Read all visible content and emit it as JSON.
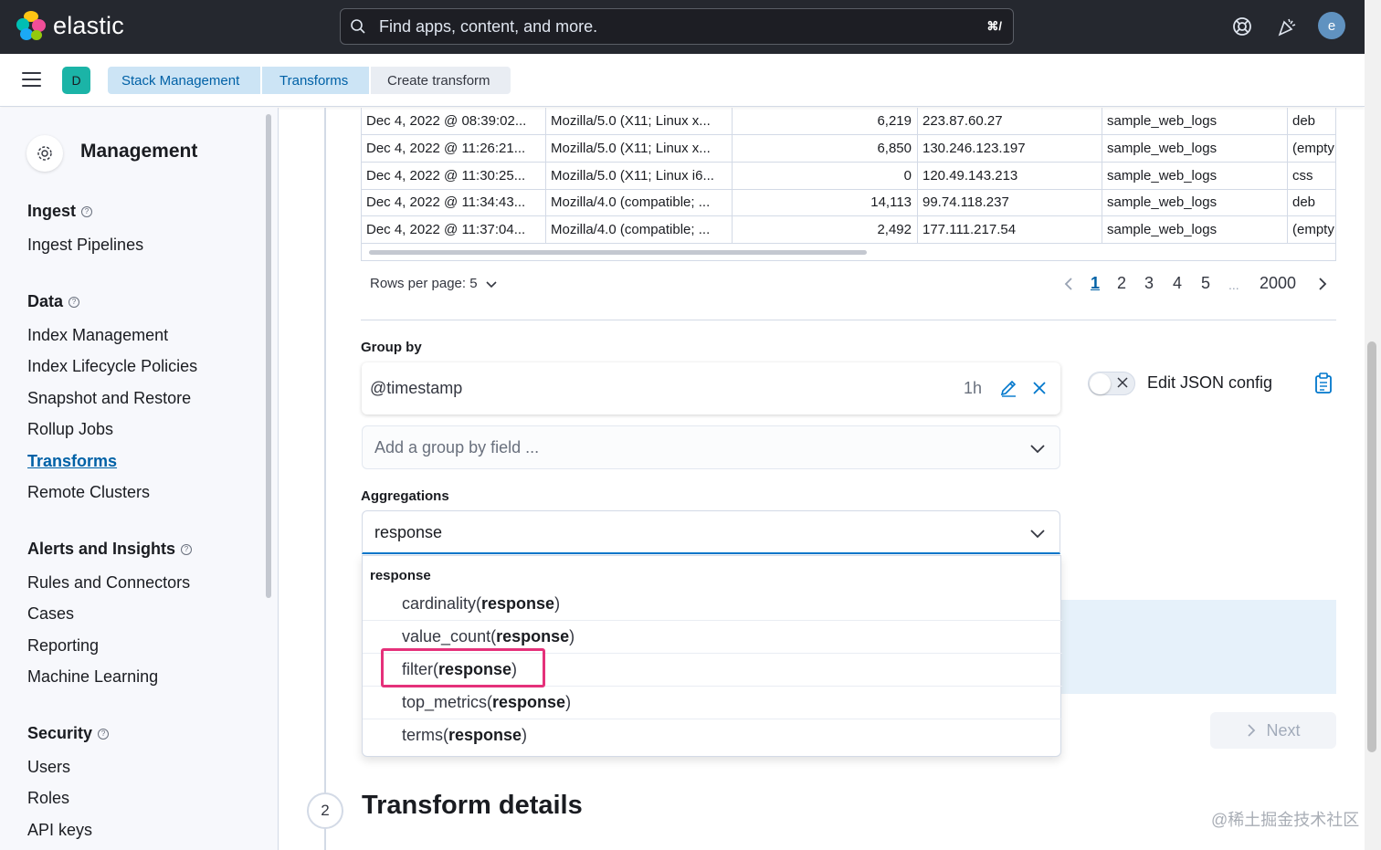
{
  "header": {
    "brand": "elastic",
    "search_placeholder": "Find apps, content, and more.",
    "search_shortcut": "⌘/",
    "user_initial": "e"
  },
  "subheader": {
    "space_initial": "D",
    "breadcrumbs": [
      "Stack Management",
      "Transforms",
      "Create transform"
    ]
  },
  "sidebar": {
    "title": "Management",
    "groups": [
      {
        "label": "Ingest",
        "items": [
          "Ingest Pipelines"
        ]
      },
      {
        "label": "Data",
        "items": [
          "Index Management",
          "Index Lifecycle Policies",
          "Snapshot and Restore",
          "Rollup Jobs",
          "Transforms",
          "Remote Clusters"
        ]
      },
      {
        "label": "Alerts and Insights",
        "items": [
          "Rules and Connectors",
          "Cases",
          "Reporting",
          "Machine Learning"
        ]
      },
      {
        "label": "Security",
        "items": [
          "Users",
          "Roles",
          "API keys"
        ]
      }
    ],
    "active_item": "Transforms"
  },
  "grid": {
    "rows": [
      [
        "Dec 4, 2022 @ 08:39:02...",
        "Mozilla/5.0 (X11; Linux x...",
        "6,219",
        "223.87.60.27",
        "sample_web_logs",
        "deb"
      ],
      [
        "Dec 4, 2022 @ 11:26:21...",
        "Mozilla/5.0 (X11; Linux x...",
        "6,850",
        "130.246.123.197",
        "sample_web_logs",
        "(empty"
      ],
      [
        "Dec 4, 2022 @ 11:30:25...",
        "Mozilla/5.0 (X11; Linux i6...",
        "0",
        "120.49.143.213",
        "sample_web_logs",
        "css"
      ],
      [
        "Dec 4, 2022 @ 11:34:43...",
        "Mozilla/4.0 (compatible; ...",
        "14,113",
        "99.74.118.237",
        "sample_web_logs",
        "deb"
      ],
      [
        "Dec 4, 2022 @ 11:37:04...",
        "Mozilla/4.0 (compatible; ...",
        "2,492",
        "177.111.217.54",
        "sample_web_logs",
        "(empty"
      ]
    ]
  },
  "pagination": {
    "rows_per_page_label": "Rows per page: 5",
    "pages": [
      "1",
      "2",
      "3",
      "4",
      "5",
      "...",
      "2000"
    ],
    "current": "1"
  },
  "group_by": {
    "label": "Group by",
    "field": "@timestamp",
    "interval": "1h",
    "add_placeholder": "Add a group by field ..."
  },
  "json_config": {
    "label": "Edit JSON config"
  },
  "aggregations": {
    "label": "Aggregations",
    "input_value": "response",
    "option_group": "response",
    "options": [
      {
        "prefix": "cardinality(",
        "match": "response",
        "suffix": ")"
      },
      {
        "prefix": "value_count(",
        "match": "response",
        "suffix": ")"
      },
      {
        "prefix": "filter(",
        "match": "response",
        "suffix": ")"
      },
      {
        "prefix": "top_metrics(",
        "match": "response",
        "suffix": ")"
      },
      {
        "prefix": "terms(",
        "match": "response",
        "suffix": ")"
      }
    ],
    "highlighted_option": "filter(response)"
  },
  "next_button": {
    "label": "Next"
  },
  "step2": {
    "number": "2",
    "title": "Transform details"
  },
  "watermark": "@稀土掘金技术社区",
  "colors": {
    "accent": "#0077cc",
    "highlight": "#e5317a",
    "topbar": "#25282f"
  }
}
